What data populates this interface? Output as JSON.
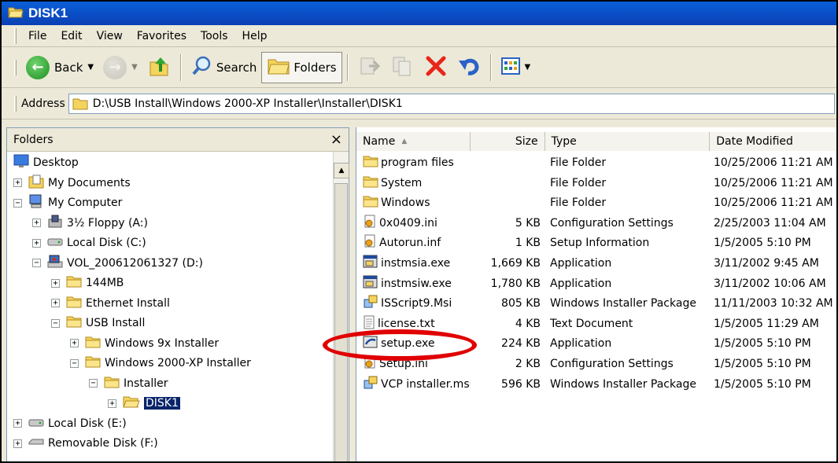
{
  "window": {
    "title": "DISK1"
  },
  "menu": [
    "File",
    "Edit",
    "View",
    "Favorites",
    "Tools",
    "Help"
  ],
  "toolbar": {
    "back_label": "Back",
    "search_label": "Search",
    "folders_label": "Folders"
  },
  "address": {
    "label": "Address",
    "path": "D:\\USB Install\\Windows 2000-XP Installer\\Installer\\DISK1"
  },
  "folders_pane": {
    "title": "Folders",
    "close": "×",
    "tree": [
      {
        "label": "Desktop",
        "level": 0,
        "expander": "",
        "icon": "desktop-icon"
      },
      {
        "label": "My Documents",
        "level": 1,
        "expander": "+",
        "icon": "my-documents-icon"
      },
      {
        "label": "My Computer",
        "level": 1,
        "expander": "−",
        "icon": "my-computer-icon"
      },
      {
        "label": "3½ Floppy (A:)",
        "level": 2,
        "expander": "+",
        "icon": "floppy-drive-icon"
      },
      {
        "label": "Local Disk (C:)",
        "level": 2,
        "expander": "+",
        "icon": "hard-drive-icon"
      },
      {
        "label": "VOL_200612061327 (D:)",
        "level": 2,
        "expander": "−",
        "icon": "cd-drive-icon"
      },
      {
        "label": "144MB",
        "level": 3,
        "expander": "+",
        "icon": "folder-icon"
      },
      {
        "label": "Ethernet Install",
        "level": 3,
        "expander": "+",
        "icon": "folder-icon"
      },
      {
        "label": "USB Install",
        "level": 3,
        "expander": "−",
        "icon": "folder-icon"
      },
      {
        "label": "Windows 9x Installer",
        "level": 4,
        "expander": "+",
        "icon": "folder-icon"
      },
      {
        "label": "Windows 2000-XP Installer",
        "level": 4,
        "expander": "−",
        "icon": "folder-icon"
      },
      {
        "label": "Installer",
        "level": 5,
        "expander": "−",
        "icon": "folder-icon"
      },
      {
        "label": "DISK1",
        "level": 6,
        "expander": "+",
        "icon": "open-folder-icon",
        "selected": true
      },
      {
        "label": "Local Disk (E:)",
        "level": 1,
        "expander": "+",
        "icon": "hard-drive-icon"
      },
      {
        "label": "Removable Disk (F:)",
        "level": 1,
        "expander": "+",
        "icon": "removable-disk-icon"
      }
    ]
  },
  "file_list": {
    "columns": [
      "Name",
      "Size",
      "Type",
      "Date Modified"
    ],
    "sort_indicator": "▲",
    "rows": [
      {
        "name": "program files",
        "size": "",
        "type": "File Folder",
        "date": "10/25/2006 11:21 AM",
        "icon": "folder-icon"
      },
      {
        "name": "System",
        "size": "",
        "type": "File Folder",
        "date": "10/25/2006 11:21 AM",
        "icon": "folder-icon"
      },
      {
        "name": "Windows",
        "size": "",
        "type": "File Folder",
        "date": "10/25/2006 11:21 AM",
        "icon": "folder-icon"
      },
      {
        "name": "0x0409.ini",
        "size": "5 KB",
        "type": "Configuration Settings",
        "date": "2/25/2003 11:04 AM",
        "icon": "settings-file-icon"
      },
      {
        "name": "Autorun.inf",
        "size": "1 KB",
        "type": "Setup Information",
        "date": "1/5/2005 5:10 PM",
        "icon": "settings-file-icon"
      },
      {
        "name": "instmsia.exe",
        "size": "1,669 KB",
        "type": "Application",
        "date": "3/11/2002 9:45 AM",
        "icon": "application-icon"
      },
      {
        "name": "instmsiw.exe",
        "size": "1,780 KB",
        "type": "Application",
        "date": "3/11/2002 10:06 AM",
        "icon": "application-icon"
      },
      {
        "name": "ISScript9.Msi",
        "size": "805 KB",
        "type": "Windows Installer Package",
        "date": "11/11/2003 10:32 AM",
        "icon": "installer-package-icon"
      },
      {
        "name": "license.txt",
        "size": "4 KB",
        "type": "Text Document",
        "date": "1/5/2005 11:29 AM",
        "icon": "text-document-icon"
      },
      {
        "name": "setup.exe",
        "size": "224 KB",
        "type": "Application",
        "date": "1/5/2005 5:10 PM",
        "icon": "setup-application-icon"
      },
      {
        "name": "Setup.ini",
        "size": "2 KB",
        "type": "Configuration Settings",
        "date": "1/5/2005 5:10 PM",
        "icon": "settings-file-icon"
      },
      {
        "name": "VCP installer.msi",
        "size": "596 KB",
        "type": "Windows Installer Package",
        "date": "1/5/2005 5:10 PM",
        "icon": "installer-package-icon"
      }
    ]
  },
  "colors": {
    "title_bar": "#0b4fd0",
    "selection": "#0a246a",
    "highlight_ring": "#e00000",
    "folder": "#f5d45e"
  }
}
